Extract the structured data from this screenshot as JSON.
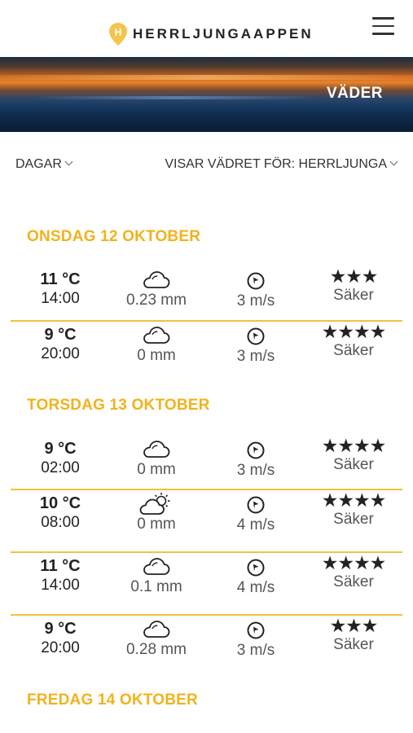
{
  "header": {
    "logo_letter": "H",
    "logo_text": "HERRLJUNGAAPPEN"
  },
  "hero": {
    "title": "VÄDER"
  },
  "filters": {
    "days_label": "DAGAR",
    "location_label": "VISAR VÄDRET FÖR: HERRLJUNGA"
  },
  "days": [
    {
      "label": "ONSDAG 12 OKTOBER",
      "rows": [
        {
          "temp": "11 °C",
          "time": "14:00",
          "weather_icon": "cloud-icon",
          "rain": "0.23 mm",
          "wind_icon": "wind-direction-icon",
          "wind": "3 m/s",
          "stars": "★★★",
          "star_count": 3,
          "certainty": "Säker"
        },
        {
          "temp": "9 °C",
          "time": "20:00",
          "weather_icon": "cloud-icon",
          "rain": "0 mm",
          "wind_icon": "wind-direction-icon",
          "wind": "3 m/s",
          "stars": "★★★★",
          "star_count": 4,
          "certainty": "Säker"
        }
      ]
    },
    {
      "label": "TORSDAG 13 OKTOBER",
      "rows": [
        {
          "temp": "9 °C",
          "time": "02:00",
          "weather_icon": "cloud-icon",
          "rain": "0 mm",
          "wind_icon": "wind-direction-icon",
          "wind": "3 m/s",
          "stars": "★★★★",
          "star_count": 4,
          "certainty": "Säker"
        },
        {
          "temp": "10 °C",
          "time": "08:00",
          "weather_icon": "partly-sunny-icon",
          "rain": "0 mm",
          "wind_icon": "wind-direction-icon",
          "wind": "4 m/s",
          "stars": "★★★★",
          "star_count": 4,
          "certainty": "Säker"
        },
        {
          "temp": "11 °C",
          "time": "14:00",
          "weather_icon": "cloud-icon",
          "rain": "0.1 mm",
          "wind_icon": "wind-direction-icon",
          "wind": "4 m/s",
          "stars": "★★★★",
          "star_count": 4,
          "certainty": "Säker"
        },
        {
          "temp": "9 °C",
          "time": "20:00",
          "weather_icon": "cloud-icon",
          "rain": "0.28 mm",
          "wind_icon": "wind-direction-icon",
          "wind": "3 m/s",
          "stars": "★★★",
          "star_count": 3,
          "certainty": "Säker"
        }
      ]
    },
    {
      "label": "FREDAG 14 OKTOBER",
      "rows": []
    }
  ],
  "colors": {
    "accent": "#f2b21c",
    "separator": "#f2c23a"
  }
}
